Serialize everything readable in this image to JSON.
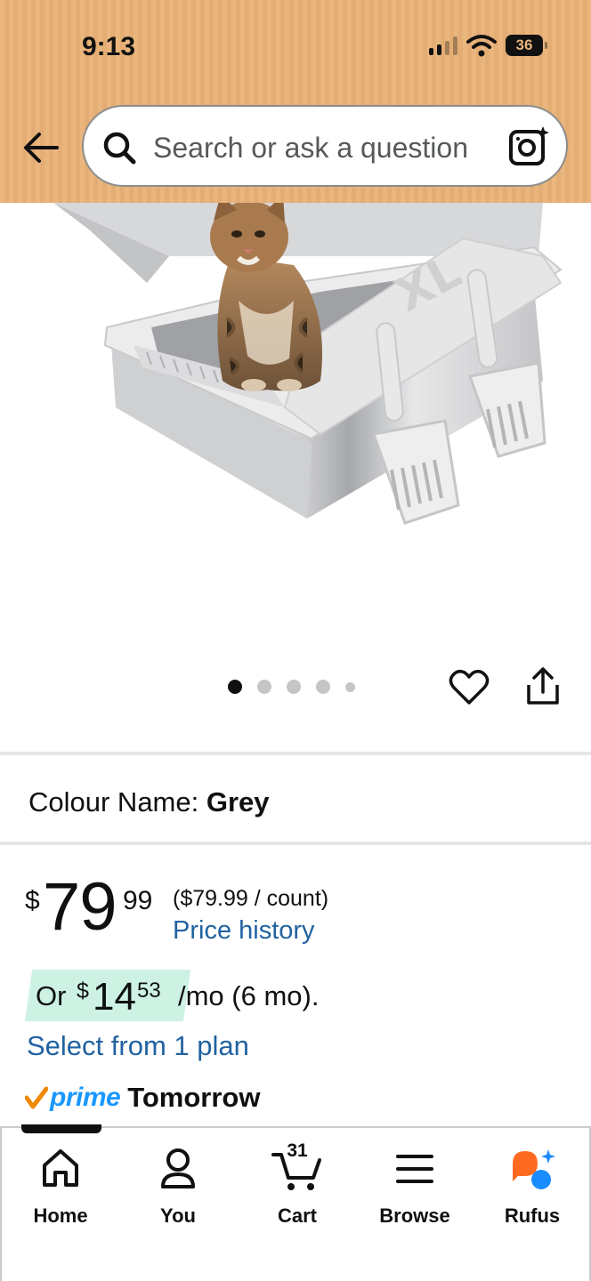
{
  "status_bar": {
    "time": "9:13",
    "battery": "36"
  },
  "header": {
    "search_placeholder": "Search or ask a question"
  },
  "product": {
    "carousel": {
      "count": 5,
      "active_index": 0
    },
    "image_text": "XL",
    "colour_label": "Colour Name:",
    "colour_value": "Grey"
  },
  "price": {
    "symbol": "$",
    "whole": "79",
    "fraction": "99",
    "unit_price": "($79.99 / count)",
    "history_link": "Price history"
  },
  "installment": {
    "prefix": "Or",
    "symbol": "$",
    "whole": "14",
    "fraction": "53",
    "suffix": "/mo (6 mo).",
    "plan_link": "Select from 1 plan"
  },
  "delivery": {
    "prime": "prime",
    "day": "Tomorrow"
  },
  "tabbar": {
    "home": "Home",
    "you": "You",
    "cart": "Cart",
    "cart_count": "31",
    "browse": "Browse",
    "rufus": "Rufus"
  },
  "colors": {
    "header_bg": "#e9b47c",
    "link": "#2162a1",
    "installment_bg": "#cdf2e3",
    "prime_blue": "#1a98ff",
    "prime_check": "#f08804",
    "rufus_orange": "#ff6a21",
    "rufus_blue": "#1a8cff"
  }
}
